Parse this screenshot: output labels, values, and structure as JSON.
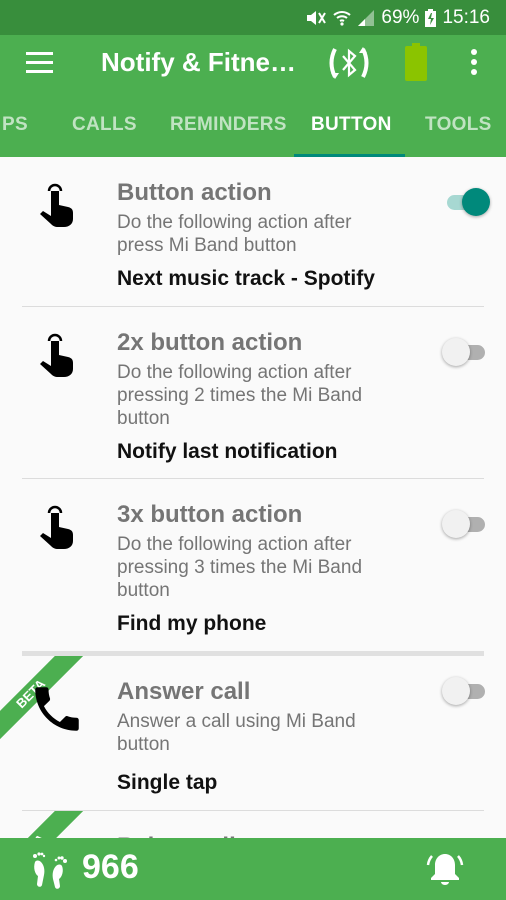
{
  "status_bar": {
    "battery_percent": "69%",
    "time": "15:16",
    "icons": [
      "mute-icon",
      "wifi-icon",
      "signal-icon",
      "battery-charging-icon"
    ]
  },
  "app_bar": {
    "title": "Notify & Fitne…",
    "icons": [
      "menu-icon",
      "bluetooth-sync-icon",
      "band-battery-icon",
      "more-vert-icon"
    ]
  },
  "tabs": [
    {
      "label": "PS",
      "active": false
    },
    {
      "label": "CALLS",
      "active": false
    },
    {
      "label": "REMINDERS",
      "active": false
    },
    {
      "label": "BUTTON",
      "active": true
    },
    {
      "label": "TOOLS",
      "active": false
    }
  ],
  "rows": [
    {
      "icon": "tap-icon",
      "title": "Button action",
      "description": "Do the following action after press Mi Band button",
      "value": "Next music track - Spotify",
      "enabled": true,
      "beta": false
    },
    {
      "icon": "tap-icon",
      "title": "2x button action",
      "description": "Do the following action after pressing 2 times the Mi Band button",
      "value": "Notify last notification",
      "enabled": false,
      "beta": false
    },
    {
      "icon": "tap-icon",
      "title": "3x button action",
      "description": "Do the following action after pressing 3 times the Mi Band button",
      "value": "Find my phone",
      "enabled": false,
      "beta": false
    },
    {
      "icon": "phone-icon",
      "title": "Answer call",
      "description": "Answer a call using Mi Band button",
      "value": "Single tap",
      "enabled": false,
      "beta": true
    },
    {
      "icon": "phone-icon",
      "title": "Reject call",
      "beta": true
    }
  ],
  "beta_label": "BETA",
  "bottom_bar": {
    "steps": "966"
  },
  "colors": {
    "status_bar": "#388e3c",
    "primary": "#4caf50",
    "accent": "#00897b",
    "band_battery": "#8bc400"
  }
}
